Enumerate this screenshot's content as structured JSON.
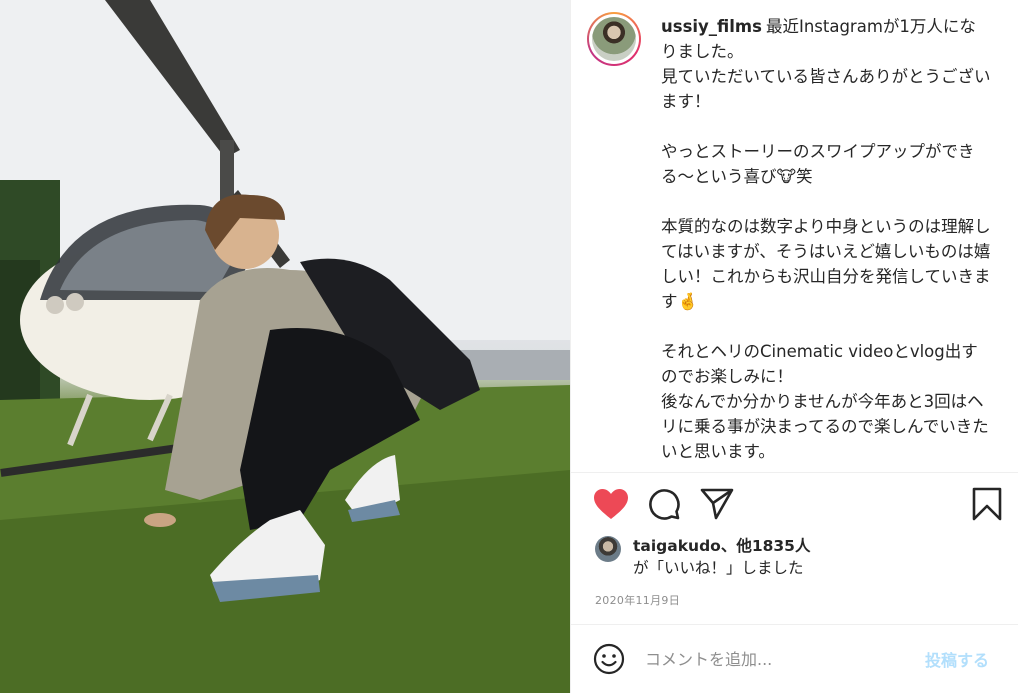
{
  "post": {
    "username": "ussiy_films",
    "caption": "最近Instagramが1万人になりました。\n見ていただいている皆さんありがとうございます！\n\nやっとストーリーのスワイプアップができる〜という喜び🐮笑\n\n本質的なのは数字より中身というのは理解してはいますが、そうはいえど嬉しいものは嬉しい！これからも沢山自分を発信していきます🤞\n\nそれとヘリのCinematic videoとvlog出すのでお楽しみに！\n後なんでか分かりませんが今年あと3回はヘリに乗る事が決まってるので楽しんでいきたいと思います。",
    "date": "2020年11月9日"
  },
  "actions": {
    "like_icon": "heart-icon",
    "comment_icon": "comment-icon",
    "share_icon": "paper-plane-icon",
    "save_icon": "bookmark-icon",
    "like_color": "#ed4956"
  },
  "likes": {
    "user": "taigakudo",
    "others": "、他1835人",
    "suffix": "が「いいね！」しました"
  },
  "comment_box": {
    "emoji_icon": "smiley-icon",
    "placeholder": "コメントを追加...",
    "post_label": "投稿する",
    "post_color": "#b2dffc"
  }
}
